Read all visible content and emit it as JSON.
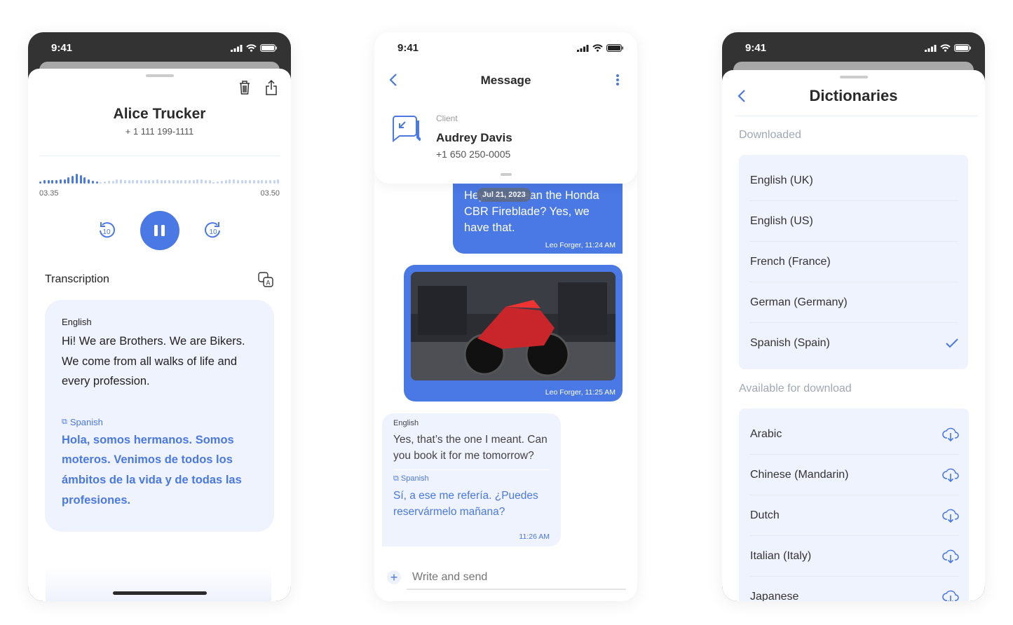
{
  "status_time": "9:41",
  "colors": {
    "accent": "#4a78e4",
    "card": "#eff3fd",
    "dark": "#333333"
  },
  "recording": {
    "name": "Alice Trucker",
    "phone": "+ 1 111 199-1111",
    "time_start": "03.35",
    "time_end": "03.50",
    "progress": 0.25,
    "transcription_label": "Transcription",
    "source_lang": "English",
    "source_text": "Hi! We are Brothers. We are Bikers. We come from all walks of life and every profession.",
    "target_lang": "Spanish",
    "target_text": "Hola, somos hermanos. Somos moteros. Venimos de todos los ámbitos de la vida y de todas las profesiones.",
    "icons": [
      "trash-icon",
      "share-icon",
      "rewind-10-icon",
      "pause-icon",
      "forward-10-icon",
      "translate-icon"
    ]
  },
  "message": {
    "title": "Message",
    "contact_role": "Client",
    "contact_name": "Audrey Davis",
    "contact_phone": "+1 650 250-0005",
    "date_pill": "Jul 21, 2023",
    "msg1": "Hey! You mean the Honda CBR Fireblade? Yes, we have that.",
    "msg1_meta": "Leo Forger, 11:24 AM",
    "msg2_meta": "Leo Forger, 11:25 AM",
    "reply_lang": "English",
    "reply_text": "Yes, that’s the one I meant. Can you book it for me tomorrow?",
    "reply_trans_lang": "Spanish",
    "reply_trans": "Sí, a ese me refería. ¿Puedes reservármelo mañana?",
    "reply_time": "11:26 AM",
    "input_placeholder": "Write and send"
  },
  "dictionaries": {
    "title": "Dictionaries",
    "downloaded_label": "Downloaded",
    "downloaded": [
      {
        "label": "English (UK)"
      },
      {
        "label": "English (US)"
      },
      {
        "label": "French (France)"
      },
      {
        "label": "German (Germany)"
      },
      {
        "label": "Spanish (Spain)",
        "selected": true
      }
    ],
    "available_label": "Available for download",
    "available": [
      {
        "label": "Arabic"
      },
      {
        "label": "Chinese (Mandarin)"
      },
      {
        "label": "Dutch"
      },
      {
        "label": "Italian (Italy)"
      },
      {
        "label": "Japanese"
      }
    ]
  }
}
